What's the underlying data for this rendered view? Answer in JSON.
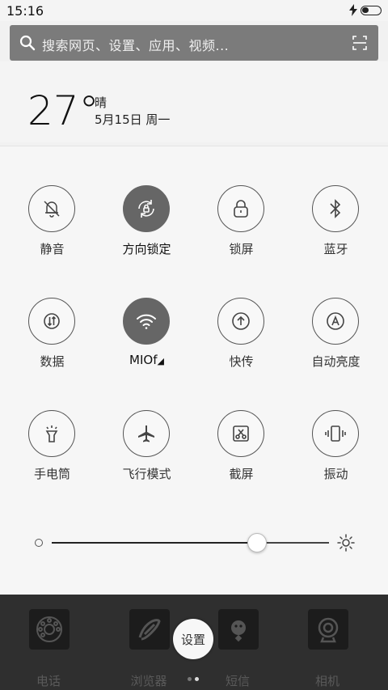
{
  "status": {
    "time": "15:16"
  },
  "search": {
    "placeholder": "搜索网页、设置、应用、视频..."
  },
  "weather": {
    "temperature": "27°",
    "condition": "晴",
    "date": "5月15日 周一"
  },
  "toggles": [
    {
      "label": "静音",
      "icon": "bell-off-icon",
      "active": false
    },
    {
      "label": "方向锁定",
      "icon": "rotation-lock-icon",
      "active": true
    },
    {
      "label": "锁屏",
      "icon": "lock-icon",
      "active": false
    },
    {
      "label": "蓝牙",
      "icon": "bluetooth-icon",
      "active": false
    },
    {
      "label": "数据",
      "icon": "data-icon",
      "active": false
    },
    {
      "label": "MIOf",
      "icon": "wifi-icon",
      "active": true
    },
    {
      "label": "快传",
      "icon": "upload-icon",
      "active": false
    },
    {
      "label": "自动亮度",
      "icon": "auto-brightness-icon",
      "active": false
    },
    {
      "label": "手电筒",
      "icon": "flashlight-icon",
      "active": false
    },
    {
      "label": "飞行模式",
      "icon": "airplane-icon",
      "active": false
    },
    {
      "label": "截屏",
      "icon": "screenshot-icon",
      "active": false
    },
    {
      "label": "振动",
      "icon": "vibrate-icon",
      "active": false
    }
  ],
  "brightness": {
    "level": 0.74
  },
  "dock": {
    "apps": [
      {
        "label": "电话",
        "icon": "phone-icon"
      },
      {
        "label": "浏览器",
        "icon": "browser-icon"
      },
      {
        "label": "短信",
        "icon": "messages-icon"
      },
      {
        "label": "相机",
        "icon": "camera-icon"
      }
    ],
    "settings_label": "设置"
  },
  "colors": {
    "active_tile": "#666666",
    "dock_bg": "#2f2f2f"
  }
}
